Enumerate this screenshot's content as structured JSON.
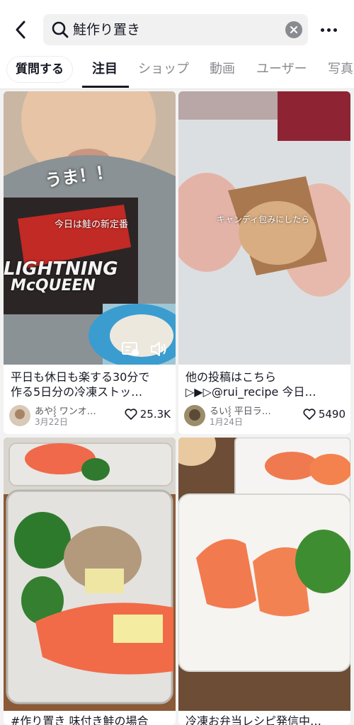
{
  "search": {
    "query": "鮭作り置き"
  },
  "icons": {
    "back": "back-arrow-icon",
    "search": "search-icon",
    "clear": "clear-icon",
    "more": "more-icon"
  },
  "tabs": {
    "pill": "質問する",
    "items": [
      "注目",
      "ショップ",
      "動画",
      "ユーザー",
      "写真"
    ],
    "active": "注目"
  },
  "cards": [
    {
      "overlay_big": "うま！！",
      "overlay_small": "今日は鮭の新定番",
      "shirt_text_1": "LIGHTNING",
      "shirt_text_2": "McQUEEN",
      "caption_line1": "平日も休日も楽する30分で",
      "caption_line2": "作る5日分の冷凍ストッ…",
      "author": "あや⸾ ワンオ…",
      "date": "3月22日",
      "likes": "25.3K"
    },
    {
      "overlay_small": "キャンディ包みにしたら",
      "caption_line1": "他の投稿はこちら",
      "caption_line2": "▷▶▷@rui_recipe 今日…",
      "author": "るい⸾ 平日ラ…",
      "date": "1月24日",
      "likes": "5490"
    },
    {
      "caption_line1": "#作り置き 味付き鮭の場合"
    },
    {
      "caption_line1": "冷凍お弁当レシピ発信中…"
    }
  ]
}
